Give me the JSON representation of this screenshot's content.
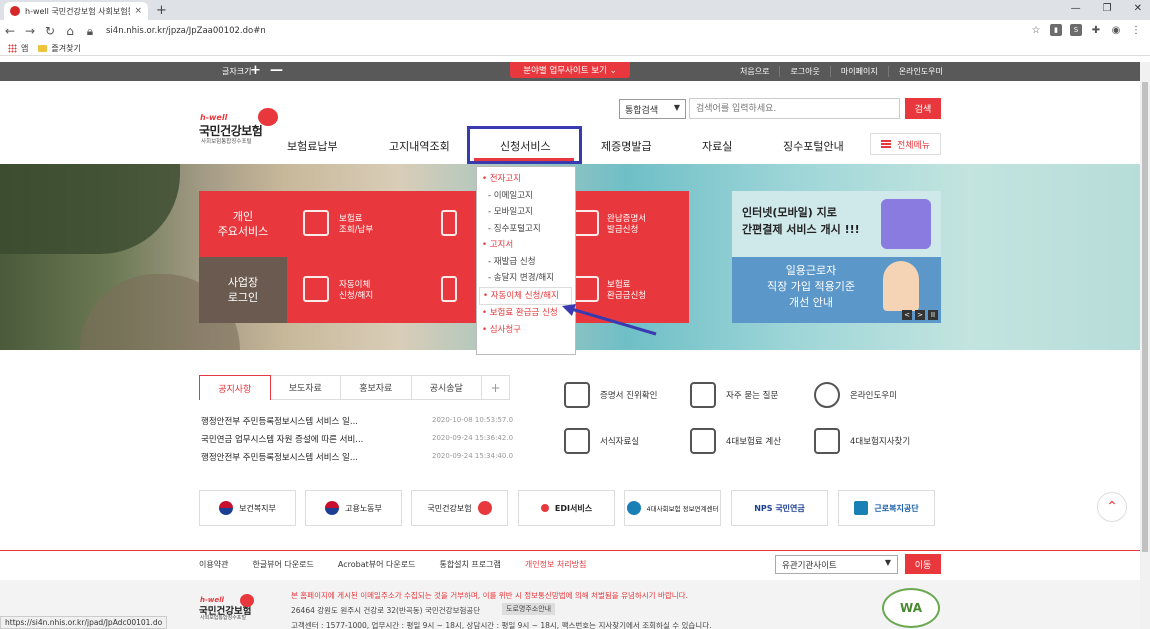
{
  "browser": {
    "tab_title": "h-well 국민건강보험 사회보험통",
    "tab_close": "×",
    "new_tab": "+",
    "url": "si4n.nhis.or.kr/jpza/JpZaa00102.do#n",
    "bookmarks": {
      "apps": "앱",
      "favorites": "즐겨찾기"
    },
    "status_url": "https://si4n.nhis.or.kr/jpad/JpAdc00101.do",
    "win": {
      "min": "—",
      "max": "❐",
      "close": "✕"
    }
  },
  "topbar": {
    "font_size": "글자크기",
    "plus": "+",
    "minus": "—",
    "site_button": "분야별 업무사이트 보기 ⌄",
    "links": [
      "처음으로",
      "로그아웃",
      "마이페이지",
      "온라인도우미"
    ]
  },
  "header": {
    "logo_brand": "h-well",
    "logo_name": "국민건강보험",
    "logo_sub": "사회보험통합징수포털",
    "search_scope": "통합검색",
    "search_placeholder": "검색어를 입력하세요.",
    "search_button": "검색",
    "nav": [
      "보험료납부",
      "고지내역조회",
      "신청서비스",
      "제증명발급",
      "자료실",
      "징수포털안내"
    ],
    "all_menu": "전체메뉴"
  },
  "services": {
    "personal": "개인\n주요서비스",
    "business": "사업장\n로그인",
    "items": [
      {
        "label": "보험료\n조회/납부"
      },
      {
        "label": "완납증명서\n발급신청"
      },
      {
        "label": "자동이체\n신청/해지"
      },
      {
        "label": "보험료\n환급금신청"
      }
    ]
  },
  "dropdown": {
    "items": [
      {
        "text": "전자고지",
        "kind": "cat"
      },
      {
        "text": "- 이메일고지",
        "kind": "sub"
      },
      {
        "text": "- 모바일고지",
        "kind": "sub"
      },
      {
        "text": "- 징수포털고지",
        "kind": "sub"
      },
      {
        "text": "고지서",
        "kind": "cat"
      },
      {
        "text": "- 재발급 신청",
        "kind": "sub"
      },
      {
        "text": "- 송달지 변경/해지",
        "kind": "sub"
      },
      {
        "text": "자동이체 신청/해지",
        "kind": "sel"
      },
      {
        "text": "보험료 환급금 신청",
        "kind": "cat"
      },
      {
        "text": "심사청구",
        "kind": "cat"
      }
    ]
  },
  "banners": {
    "b1": "인터넷(모바일) 지로\n간편결제 서비스 개시 !!!",
    "b2": "일용근로자\n직장 가입 적용기준\n개선 안내",
    "controls": [
      "<",
      ">",
      "II"
    ]
  },
  "notice": {
    "tabs": [
      "공지사항",
      "보도자료",
      "홍보자료",
      "공시송달"
    ],
    "plus": "+",
    "items": [
      {
        "title": "행정안전부 주민등록정보시스템 서비스 일...",
        "date": "2020-10-08 10:53:57.0"
      },
      {
        "title": "국민연금 업무시스템 자원 증설에 따른 서비...",
        "date": "2020-09-24 15:36:42.0"
      },
      {
        "title": "행정안전부 주민등록정보시스템 서비스 일...",
        "date": "2020-09-24 15:34:40.0"
      }
    ]
  },
  "quicklinks": [
    "증명서 진위확인",
    "자주 묻는 질문",
    "온라인도우미",
    "서식자료실",
    "4대보험료 계산",
    "4대보험지사찾기"
  ],
  "partners": [
    "보건복지부",
    "고용노동부",
    "국민건강보험",
    "EDI서비스",
    "4대사회보험 정보연계센터",
    "NPS 국민연금",
    "근로복지공단"
  ],
  "footer": {
    "links": [
      "이용약관",
      "한글뷰어 다운로드",
      "Acrobat뷰어 다운로드",
      "통합설치 프로그램",
      "개인정보 처리방침"
    ],
    "related": "유관기관사이트",
    "go": "이동",
    "warning": "본 홈페이지에 게시된 이메일주소가 수집되는 것을 거부하며, 이를 위반 시 정보통신망법에 의해 처벌됨을 유념하시기 바랍니다.",
    "address": "26464 강원도 원주시 건강로 32(반곡동) 국민건강보험공단",
    "road": "도로명주소안내",
    "center": "고객센터 : 1577-1000, 업무시간 : 평일 9시 ~ 18시, 상담시간 : 평일 9시 ~ 18시, 팩스번호는 지사찾기에서 조회하실 수 있습니다.",
    "wa": "WA"
  },
  "colors": {
    "accent": "#e8383d",
    "highlight": "#3a3ab0"
  }
}
